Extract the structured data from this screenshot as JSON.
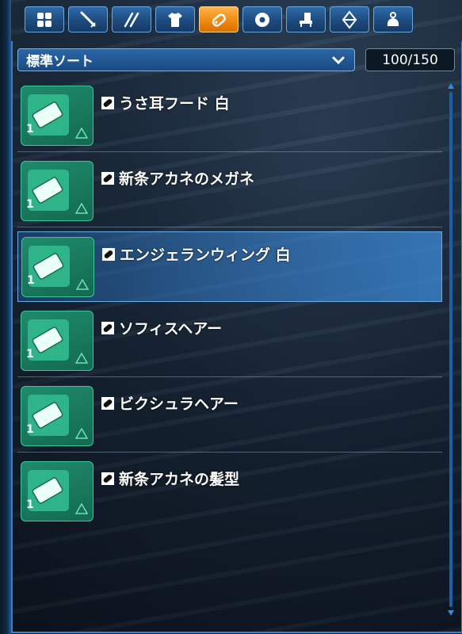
{
  "tabs": [
    {
      "icon": "grid-icon",
      "active": false
    },
    {
      "icon": "sword-icon",
      "active": false
    },
    {
      "icon": "double-slash-icon",
      "active": false
    },
    {
      "icon": "shirt-icon",
      "active": false
    },
    {
      "icon": "tag-icon",
      "active": true
    },
    {
      "icon": "disc-icon",
      "active": false
    },
    {
      "icon": "stool-icon",
      "active": false
    },
    {
      "icon": "crystal-icon",
      "active": false
    },
    {
      "icon": "bag-icon",
      "active": false
    }
  ],
  "sort": {
    "label": "標準ソート"
  },
  "counter": "100/150",
  "items": [
    {
      "name": "うさ耳フード  白",
      "qty": "1",
      "selected": false
    },
    {
      "name": "新条アカネのメガネ",
      "qty": "1",
      "selected": false
    },
    {
      "name": "エンジェランウィング  白",
      "qty": "1",
      "selected": true
    },
    {
      "name": "ソフィスヘアー",
      "qty": "1",
      "selected": false
    },
    {
      "name": "ビクシュラヘアー",
      "qty": "1",
      "selected": false
    },
    {
      "name": "新条アカネの髪型",
      "qty": "1",
      "selected": false
    }
  ],
  "colors": {
    "accent": "#f08a10",
    "selected_row": "#3c8cdc",
    "item_bg": "#1f8a6c"
  }
}
